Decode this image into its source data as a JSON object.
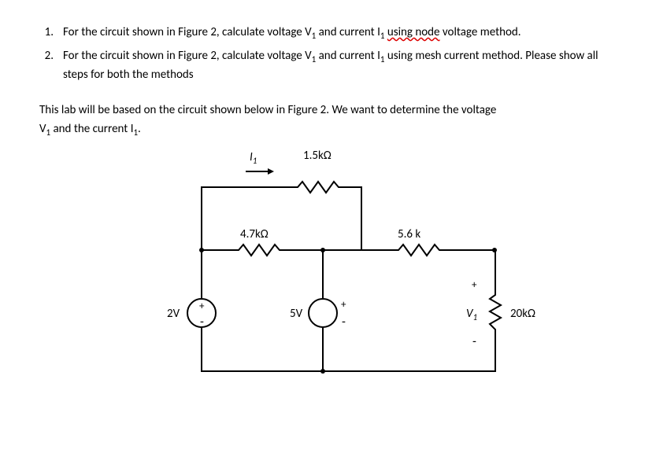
{
  "questions": [
    {
      "num": "1.",
      "pre": "For the circuit shown in Figure 2, calculate voltage V",
      "sub1": "1",
      "mid1": " and current I",
      "sub2": "1",
      "mid2": " ",
      "underlined": "using node",
      "post": " voltage method."
    },
    {
      "num": "2.",
      "pre": "For the circuit shown in Figure 2, calculate voltage V",
      "sub1": "1",
      "mid1": " and current I",
      "sub2": "1",
      "mid2": " using mesh current method. Please show all steps for both the methods",
      "underlined": "",
      "post": ""
    }
  ],
  "intro": {
    "line1a": "This lab will be based on the circuit shown below in Figure 2. We want to determine the voltage",
    "line2a": "V",
    "line2sub1": "1",
    "line2b": " and the current I",
    "line2sub2": "1",
    "line2c": "."
  },
  "circuit": {
    "I1": "I",
    "I1sub": "1",
    "R1": "1.5kΩ",
    "R2": "4.7kΩ",
    "R3": "5.6 k",
    "R4": "20kΩ",
    "Vs1": "2V",
    "Vs2": "5V",
    "V1": "V",
    "V1sub": "1",
    "plus": "+",
    "minus": "-"
  }
}
